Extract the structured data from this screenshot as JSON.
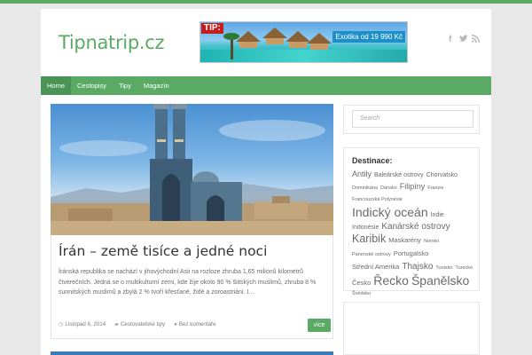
{
  "site": {
    "logo_text": "Tipnatrip.cz",
    "accent": "#5aaa65"
  },
  "banner": {
    "tip_label": "TIP:",
    "offer_text": "Exotika od 19 990 Kč"
  },
  "social": {
    "icons": [
      "facebook-icon",
      "twitter-icon",
      "rss-icon"
    ],
    "glyphs": [
      "f",
      "t",
      "rss"
    ]
  },
  "nav": {
    "items": [
      "Home",
      "Cestopisy",
      "Tipy",
      "Magazín"
    ],
    "active": "Home"
  },
  "post": {
    "title": "Írán – země tisíce a jedné noci",
    "excerpt": "Íránská republika se nachází v jihovýchodní Asii na rozloze zhruba 1,65 milionů kilometrů čtverečních. Jedná se o multikulturní zemi, kde žije okolo 90 % šiitských muslimů, zhruba 8 % sunnitských muslimů a zbylá 2 % tvoří křesťané, židé a zoroastriáni. I…",
    "date": "Listopad 6, 2014",
    "category": "Cestovatelské tipy",
    "comments": "Bez komentáře",
    "more_label": "více"
  },
  "search": {
    "placeholder": "Search"
  },
  "destinations": {
    "title": "Destinace:",
    "tags": [
      {
        "label": "Antily",
        "size": 9
      },
      {
        "label": "Baleárské ostrovy",
        "size": 7
      },
      {
        "label": "Chorvatsko",
        "size": 7
      },
      {
        "label": "Dominikána",
        "size": 5.5
      },
      {
        "label": "Dánsko",
        "size": 5.5
      },
      {
        "label": "Filipíny",
        "size": 9
      },
      {
        "label": "Francie",
        "size": 5.5
      },
      {
        "label": "Francouzská Polynésie",
        "size": 5.5
      },
      {
        "label": "Indický oceán",
        "size": 14
      },
      {
        "label": "Indie",
        "size": 7
      },
      {
        "label": "Indonésie",
        "size": 7
      },
      {
        "label": "Kanárské ostrovy",
        "size": 10
      },
      {
        "label": "Karibik",
        "size": 12.5
      },
      {
        "label": "Maskarény",
        "size": 7.5
      },
      {
        "label": "Norsko",
        "size": 5.5
      },
      {
        "label": "Panenské ostrovy",
        "size": 5.5
      },
      {
        "label": "Portugalsko",
        "size": 7.5
      },
      {
        "label": "Střední Amerika",
        "size": 7.5
      },
      {
        "label": "Thajsko",
        "size": 10
      },
      {
        "label": "Tunisko",
        "size": 5.5
      },
      {
        "label": "Turecko",
        "size": 5.5
      },
      {
        "label": "Česko",
        "size": 7.5
      },
      {
        "label": "Řecko",
        "size": 14
      },
      {
        "label": "Španělsko",
        "size": 14
      },
      {
        "label": "Švédsko",
        "size": 5.5
      }
    ]
  }
}
